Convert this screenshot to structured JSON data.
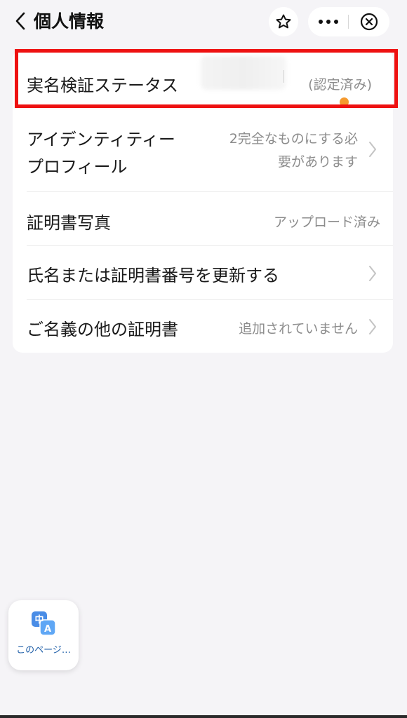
{
  "header": {
    "title": "個人情報",
    "back_icon": "chevron-left-icon",
    "star_icon": "star-icon",
    "more_icon": "more-dots-icon",
    "close_icon": "close-circle-icon"
  },
  "rows": [
    {
      "label": "実名検証ステータス",
      "value": "(認定済み)",
      "has_chevron": false
    },
    {
      "label_lines": [
        "アイデンティティー",
        "プロフィール"
      ],
      "value_lines": [
        "2完全なものにする必",
        "要があります"
      ],
      "has_chevron": true,
      "has_dot": true
    },
    {
      "label": "証明書写真",
      "value": "アップロード済み",
      "has_chevron": false
    },
    {
      "label": "氏名または証明書番号を更新する",
      "value": "",
      "has_chevron": true
    },
    {
      "label": "ご名義の他の証明書",
      "value": "追加されていません",
      "has_chevron": true
    }
  ],
  "translate_widget": {
    "label": "このページ…",
    "icon": "translate-icon",
    "glyph_top": "中",
    "glyph_bottom": "A"
  },
  "colors": {
    "background": "#f5f4f7",
    "card": "#ffffff",
    "highlight": "#ee1111",
    "dot": "#f59a2e",
    "secondary_text": "#8c8c8c"
  }
}
